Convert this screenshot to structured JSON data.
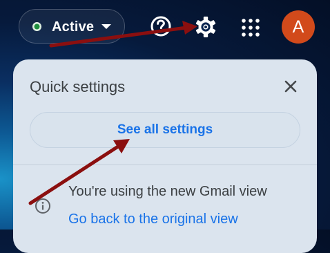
{
  "topbar": {
    "status_label": "Active",
    "status_color": "#1e8e3e",
    "icons": [
      "help-icon",
      "gear-icon",
      "apps-icon"
    ],
    "avatar_initial": "A",
    "avatar_color": "#d24a1b"
  },
  "quick_settings": {
    "title": "Quick settings",
    "close_icon": "close-icon",
    "see_all_label": "See all settings",
    "view_note": "You're using the new Gmail view",
    "back_link": "Go back to the original view",
    "link_color": "#1a73e8"
  },
  "annotations": {
    "arrow_color": "#8b0f0f"
  }
}
